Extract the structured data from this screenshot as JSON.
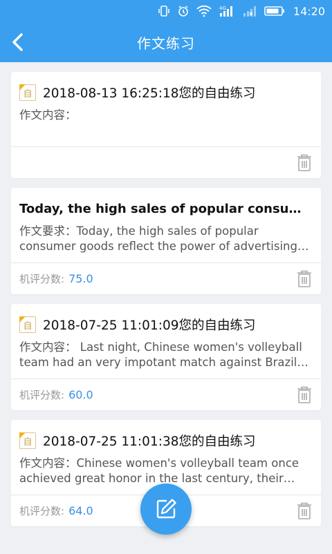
{
  "status_bar": {
    "time": "14:20",
    "icons": [
      "vibrate-icon",
      "alarm-icon",
      "wifi-icon",
      "signal-4g-icon",
      "signal-empty-icon",
      "battery-icon"
    ]
  },
  "appbar": {
    "title": "作文练习",
    "back_icon": "back-arrow-icon"
  },
  "cards": [
    {
      "type": "free",
      "title": "2018-08-13 16:25:18您的自由练习",
      "text": "作文内容：",
      "score_label": "",
      "score": ""
    },
    {
      "type": "topic",
      "title": "Today, the high sales of popular consumer goods reflect the power of advertising",
      "text": "作文要求：Today, the high sales of popular consumer goods reflect the power of advertising and not the real needs of the society in which they are sold.",
      "score_label": "机评分数:",
      "score": "75.0"
    },
    {
      "type": "free",
      "title": "2018-07-25 11:01:09您的自由练习",
      "text": "作文内容：  Last night, Chinese women's volleyball team had an very impotant match against Brazil and won.",
      "score_label": "机评分数:",
      "score": "60.0"
    },
    {
      "type": "free",
      "title": "2018-07-25 11:01:38您的自由练习",
      "text": "作文内容：Chinese women's volleyball team once achieved great honor in the last century, their spirit",
      "score_label": "机评分数:",
      "score": "64.0"
    }
  ],
  "tag_icon_char": "自",
  "fab_icon": "edit-icon",
  "colors": {
    "primary": "#3a9fee",
    "score": "#3a8ee6",
    "tag": "#f3b21c"
  }
}
